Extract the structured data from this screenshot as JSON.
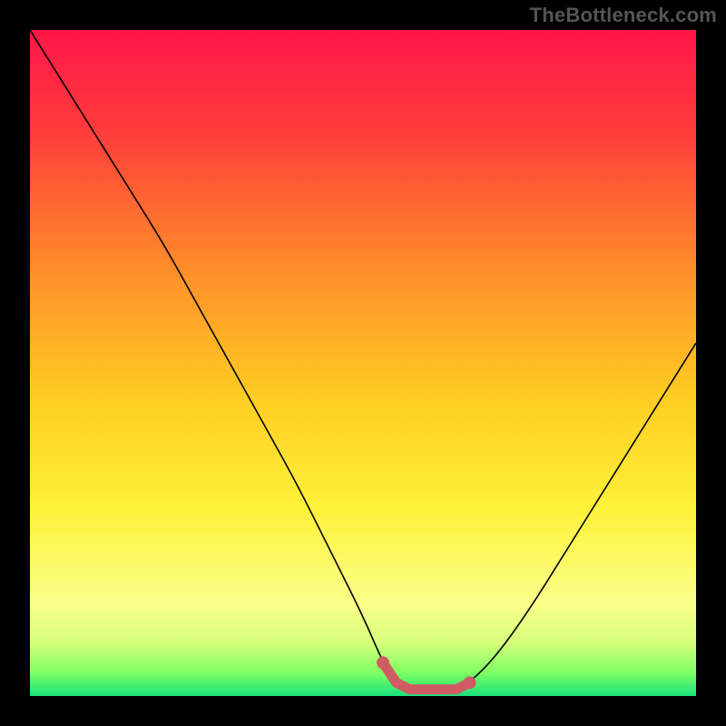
{
  "watermark": "TheBottleneck.com",
  "chart_data": {
    "type": "line",
    "title": "",
    "xlabel": "",
    "ylabel": "",
    "xlim": [
      0,
      100
    ],
    "ylim": [
      0,
      100
    ],
    "series": [
      {
        "name": "bottleneck-curve",
        "x": [
          0,
          5,
          10,
          15,
          20,
          25,
          30,
          35,
          40,
          45,
          50,
          53,
          55,
          58,
          60,
          62,
          64,
          66,
          70,
          75,
          80,
          85,
          90,
          95,
          100
        ],
        "y": [
          100,
          92,
          84,
          76,
          68,
          59,
          50,
          41,
          32,
          22,
          12,
          5,
          2,
          1,
          1,
          1,
          1,
          2,
          6,
          13,
          21,
          29,
          37,
          45,
          53
        ]
      }
    ],
    "highlight": {
      "name": "best-fit-region",
      "x": [
        53,
        55,
        57,
        59,
        60,
        61,
        62,
        63,
        64,
        65,
        66
      ],
      "y": [
        5,
        2,
        1,
        1,
        1,
        1,
        1,
        1,
        1,
        1.5,
        2
      ]
    },
    "gradient_stops": [
      {
        "offset": 0,
        "color": "#ff1648"
      },
      {
        "offset": 0.15,
        "color": "#ff3b3b"
      },
      {
        "offset": 0.35,
        "color": "#ff8a2a"
      },
      {
        "offset": 0.55,
        "color": "#ffcc22"
      },
      {
        "offset": 0.72,
        "color": "#fff23a"
      },
      {
        "offset": 0.86,
        "color": "#faff8a"
      },
      {
        "offset": 0.92,
        "color": "#d6ff7a"
      },
      {
        "offset": 0.965,
        "color": "#7dff63"
      },
      {
        "offset": 1.0,
        "color": "#18e27a"
      }
    ],
    "highlight_color": "#cf5a62"
  }
}
